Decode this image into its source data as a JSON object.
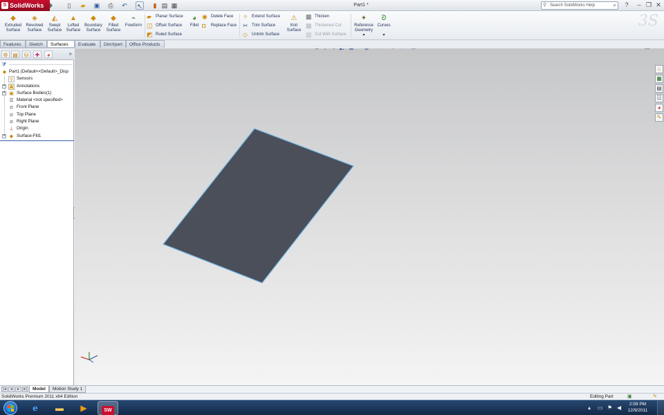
{
  "app": {
    "brand": "SolidWorks",
    "document_title": "Part1 *"
  },
  "title_bar": {
    "search_placeholder": "Search SolidWorks Help",
    "help_label": "?"
  },
  "ribbon": {
    "large_buttons": [
      {
        "label_l1": "Extruded",
        "label_l2": "Surface",
        "icon": "extruded-surface-icon"
      },
      {
        "label_l1": "Revolved",
        "label_l2": "Surface",
        "icon": "revolved-surface-icon"
      },
      {
        "label_l1": "Swept",
        "label_l2": "Surface",
        "icon": "swept-surface-icon"
      },
      {
        "label_l1": "Lofted",
        "label_l2": "Surface",
        "icon": "lofted-surface-icon"
      },
      {
        "label_l1": "Boundary",
        "label_l2": "Surface",
        "icon": "boundary-surface-icon"
      },
      {
        "label_l1": "Filled",
        "label_l2": "Surface",
        "icon": "filled-surface-icon"
      },
      {
        "label_l1": "Freeform",
        "label_l2": "",
        "icon": "freeform-icon"
      }
    ],
    "group2": [
      {
        "label": "Planar Surface",
        "icon": "planar-surface-icon"
      },
      {
        "label": "Offset Surface",
        "icon": "offset-surface-icon"
      },
      {
        "label": "Ruled Surface",
        "icon": "ruled-surface-icon"
      }
    ],
    "fillet_label": "Fillet",
    "group3": [
      {
        "label": "Delete Face",
        "icon": "delete-face-icon"
      },
      {
        "label": "Replace Face",
        "icon": "replace-face-icon"
      }
    ],
    "group4": [
      {
        "label": "Extend Surface",
        "icon": "extend-surface-icon"
      },
      {
        "label": "Trim Surface",
        "icon": "trim-surface-icon"
      },
      {
        "label": "Untrim Surface",
        "icon": "untrim-surface-icon"
      }
    ],
    "knit": {
      "label_l1": "Knit",
      "label_l2": "Surface"
    },
    "group5": [
      {
        "label": "Thicken",
        "icon": "thicken-icon",
        "enabled": true
      },
      {
        "label": "Thickened Cut",
        "icon": "thickened-cut-icon",
        "enabled": false
      },
      {
        "label": "Cut With Surface",
        "icon": "cut-with-surface-icon",
        "enabled": false
      }
    ],
    "reference_geometry": {
      "label_l1": "Reference",
      "label_l2": "Geometry"
    },
    "curves": {
      "label": "Curves"
    }
  },
  "command_tabs": [
    "Features",
    "Sketch",
    "Surfaces",
    "Evaluate",
    "DimXpert",
    "Office Products"
  ],
  "active_command_tab": "Surfaces",
  "feature_tree": [
    {
      "label": "Part1  (Default<<Default>_Disp",
      "icon": "part-icon",
      "indent": 0,
      "expandable": false
    },
    {
      "label": "Sensors",
      "icon": "sensors-icon",
      "indent": 1,
      "expandable": false
    },
    {
      "label": "Annotations",
      "icon": "annotations-icon",
      "indent": 1,
      "expandable": true
    },
    {
      "label": "Surface Bodies(1)",
      "icon": "surface-bodies-icon",
      "indent": 1,
      "expandable": true
    },
    {
      "label": "Material <not specified>",
      "icon": "material-icon",
      "indent": 1,
      "expandable": false
    },
    {
      "label": "Front Plane",
      "icon": "plane-icon",
      "indent": 1,
      "expandable": false
    },
    {
      "label": "Top Plane",
      "icon": "plane-icon",
      "indent": 1,
      "expandable": false
    },
    {
      "label": "Right Plane",
      "icon": "plane-icon",
      "indent": 1,
      "expandable": false
    },
    {
      "label": "Origin",
      "icon": "origin-icon",
      "indent": 1,
      "expandable": false
    },
    {
      "label": "Surface-Fill1",
      "icon": "surface-fill-icon",
      "indent": 1,
      "expandable": true
    }
  ],
  "bottom_tabs": [
    "Model",
    "Motion Study 1"
  ],
  "active_bottom_tab": "Model",
  "status_bar": {
    "edition": "SolidWorks Premium 2011 x64 Edition",
    "mode": "Editing Part"
  },
  "taskbar": {
    "clock_time": "2:59 PM",
    "clock_date": "12/9/2011"
  },
  "colors": {
    "surface_fill": "#4b4f59",
    "surface_edge": "#6fb6e6",
    "brand_red": "#c8102e"
  }
}
